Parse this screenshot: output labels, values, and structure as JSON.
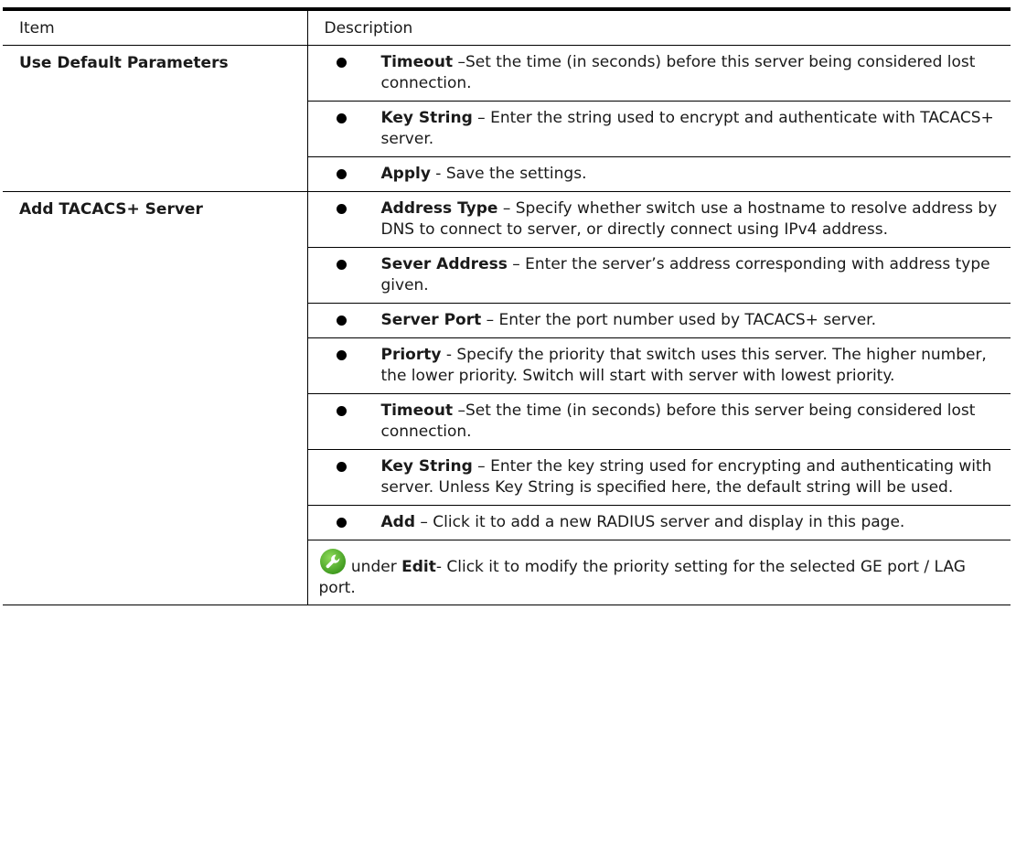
{
  "table": {
    "headers": {
      "item": "Item",
      "description": "Description"
    },
    "rows": [
      {
        "item": "Use Default Parameters",
        "bullets": [
          {
            "term": "Timeout",
            "text": " –Set the time (in seconds) before this server being considered lost connection."
          },
          {
            "term": "Key String",
            "text": " – Enter the string used to encrypt and authenticate with TACACS+ server."
          },
          {
            "term": "Apply",
            "text": " - Save the settings."
          }
        ]
      },
      {
        "item": "Add TACACS+ Server",
        "bullets": [
          {
            "term": "Address Type",
            "text": " – Specify whether switch use a hostname to resolve address by DNS to connect to server, or directly connect using IPv4 address."
          },
          {
            "term": "Sever Address",
            "text": " – Enter the server’s address corresponding with address type given."
          },
          {
            "term": "Server Port",
            "text": " – Enter the port number used by TACACS+ server."
          },
          {
            "term": "Priorty",
            "text": " - Specify the priority that switch uses this server. The higher number, the lower priority. Switch will start with server with lowest priority."
          },
          {
            "term": "Timeout",
            "text": " –Set the time (in seconds) before this server being considered lost connection."
          },
          {
            "term": "Key String",
            "text": " – Enter the key string used for encrypting and authenticating with server. Unless Key String is specified here, the default string will be used."
          },
          {
            "term": "Add",
            "text": " – Click it to add a new RADIUS server and display in this page."
          }
        ],
        "edit_note": {
          "icon": "wrench-icon",
          "prefix": "under ",
          "term": "Edit",
          "text": "- Click it to modify the priority setting for the selected GE port / LAG port."
        }
      }
    ]
  },
  "colors": {
    "icon_green": "#5cb531",
    "rule": "#000000"
  }
}
